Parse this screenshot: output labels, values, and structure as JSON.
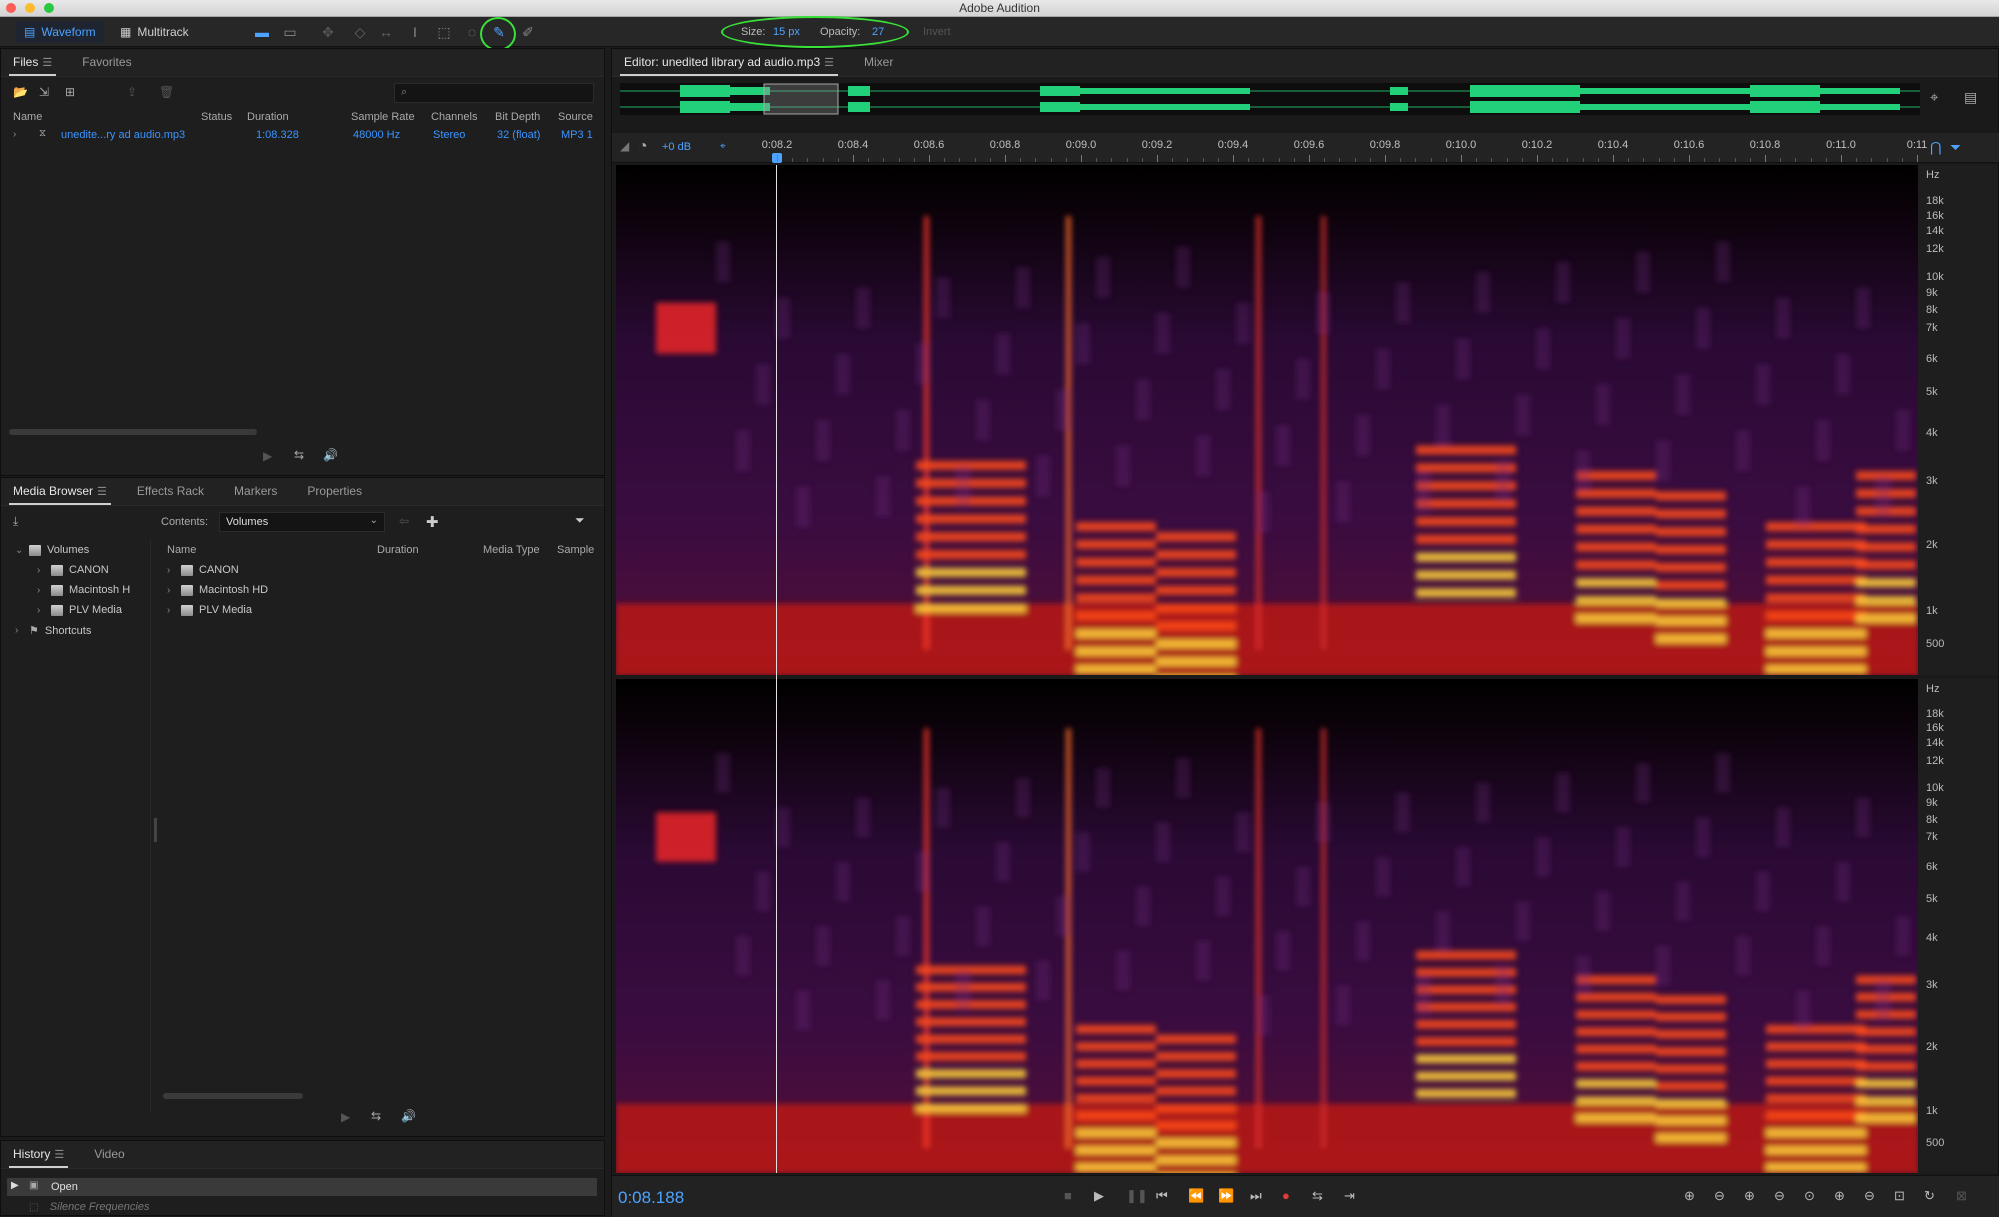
{
  "app_title": "Adobe Audition",
  "toolbar": {
    "waveform_label": "Waveform",
    "multitrack_label": "Multitrack",
    "size_label": "Size:",
    "size_value": "15 px",
    "opacity_label": "Opacity:",
    "opacity_value": "27",
    "invert_label": "Invert"
  },
  "files_panel": {
    "tabs": [
      "Files",
      "Favorites"
    ],
    "columns": {
      "name": "Name",
      "status": "Status",
      "duration": "Duration",
      "sample_rate": "Sample Rate",
      "channels": "Channels",
      "bit_depth": "Bit Depth",
      "source": "Source"
    },
    "file": {
      "name": "unedite...ry ad audio.mp3",
      "duration": "1:08.328",
      "sample_rate": "48000 Hz",
      "channels": "Stereo",
      "bit_depth": "32 (float)",
      "source": "MP3 1"
    }
  },
  "media_browser": {
    "tabs": [
      "Media Browser",
      "Effects Rack",
      "Markers",
      "Properties"
    ],
    "contents_label": "Contents:",
    "contents_value": "Volumes",
    "tree": {
      "volumes": "Volumes",
      "canon": "CANON",
      "macintosh": "Macintosh H",
      "plv": "PLV Media",
      "shortcuts": "Shortcuts"
    },
    "columns": {
      "name": "Name",
      "duration": "Duration",
      "media_type": "Media Type",
      "sample": "Sample"
    },
    "items": [
      "CANON",
      "Macintosh HD",
      "PLV Media"
    ]
  },
  "history_panel": {
    "tabs": [
      "History",
      "Video"
    ],
    "items": [
      "Open",
      "Silence Frequencies"
    ]
  },
  "editor": {
    "tab_title": "Editor: unedited library ad audio.mp3",
    "mixer_label": "Mixer",
    "gain_label": "+0 dB",
    "ruler_labels": [
      "0:08.2",
      "0:08.4",
      "0:08.6",
      "0:08.8",
      "0:09.0",
      "0:09.2",
      "0:09.4",
      "0:09.6",
      "0:09.8",
      "0:10.0",
      "0:10.2",
      "0:10.4",
      "0:10.6",
      "0:10.8",
      "0:11.0",
      "0:11"
    ],
    "freq_labels": [
      "Hz",
      "18k",
      "16k",
      "14k",
      "12k",
      "10k",
      "9k",
      "8k",
      "7k",
      "6k",
      "5k",
      "4k",
      "3k",
      "2k",
      "1k",
      "500"
    ],
    "timecode": "0:08.188"
  }
}
